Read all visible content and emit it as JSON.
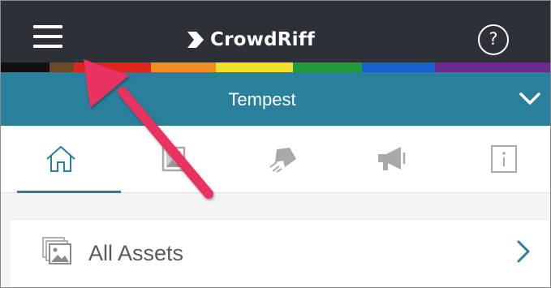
{
  "header": {
    "menu_icon": "hamburger-menu-icon",
    "brand_name": "CrowdRiff",
    "brand_icon": "crowdriff-logo-icon",
    "help_label": "?",
    "background": "#2d3036"
  },
  "rainbow_colors": [
    "#111111",
    "#6b4a2c",
    "#e0261c",
    "#f28c1e",
    "#f3df2a",
    "#1f9b3a",
    "#1a5fcf",
    "#6e2a8e"
  ],
  "project": {
    "name": "Tempest",
    "dropdown_icon": "chevron-down-icon",
    "background": "#2a7f9b"
  },
  "tabs": [
    {
      "icon": "home-icon",
      "active": true
    },
    {
      "icon": "gallery-icon",
      "active": false
    },
    {
      "icon": "arrow-share-icon",
      "active": false
    },
    {
      "icon": "megaphone-icon",
      "active": false
    },
    {
      "icon": "info-icon",
      "active": false
    }
  ],
  "list": {
    "items": [
      {
        "label": "All Assets",
        "icon": "image-stack-icon",
        "chevron": "chevron-right-icon"
      }
    ]
  },
  "annotation": {
    "type": "arrow",
    "color": "#e8315f",
    "points_to": "hamburger-menu-icon"
  },
  "colors": {
    "accent": "#2a7f9b",
    "tab_icon": "#a9a9a9"
  }
}
